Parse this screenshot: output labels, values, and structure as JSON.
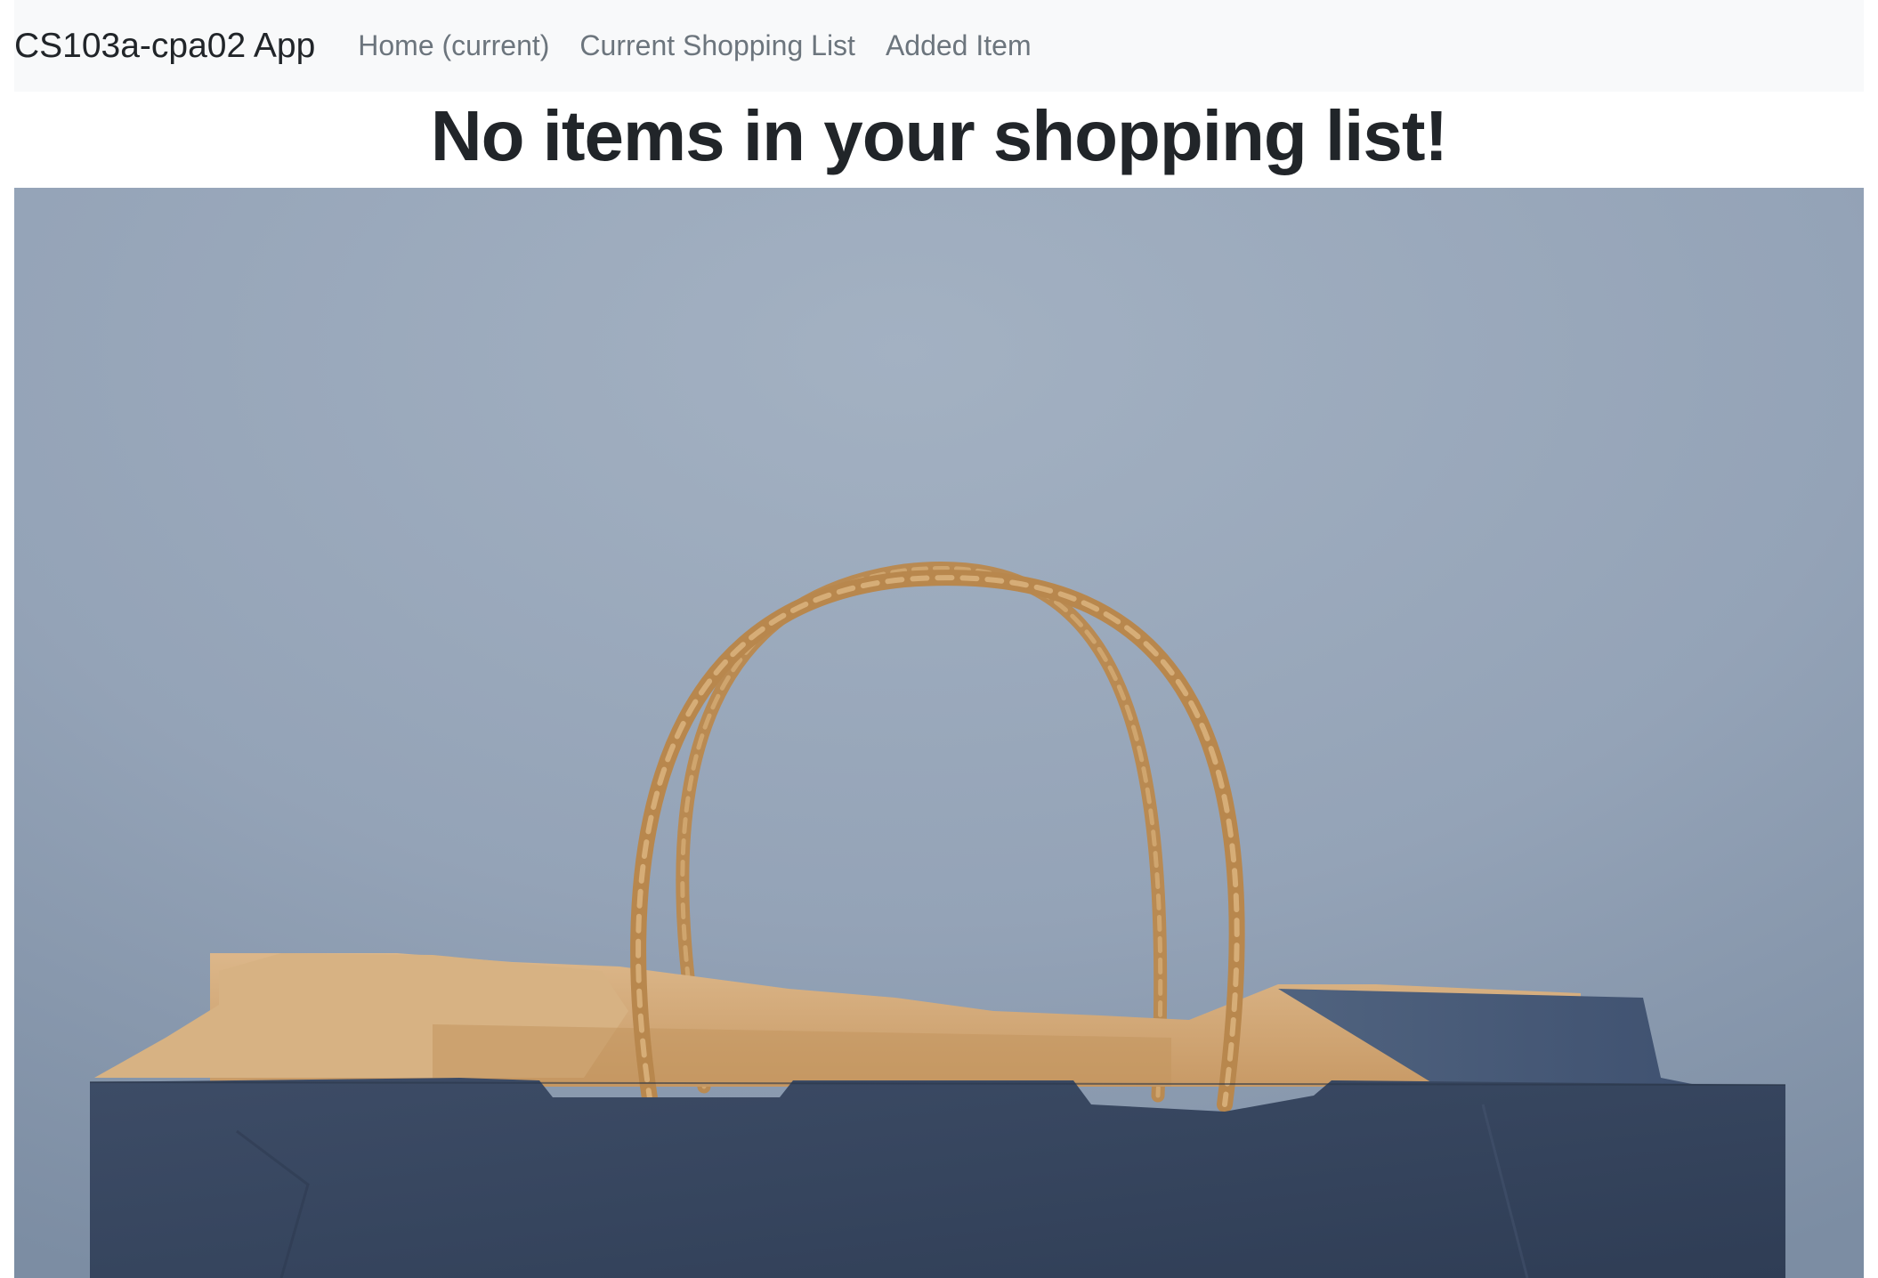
{
  "navbar": {
    "brand": "CS103a-cpa02 App",
    "links": [
      {
        "label": "Home (current)"
      },
      {
        "label": "Current Shopping List"
      },
      {
        "label": "Added Item"
      }
    ]
  },
  "main": {
    "heading": "No items in your shopping list!",
    "image": {
      "subject": "shopping-bag-photo",
      "colors": {
        "background": "#97a6b9",
        "bag_outer": "#3a4a63",
        "bag_inner": "#d6ae7f",
        "handle": "#c9975d"
      }
    }
  }
}
